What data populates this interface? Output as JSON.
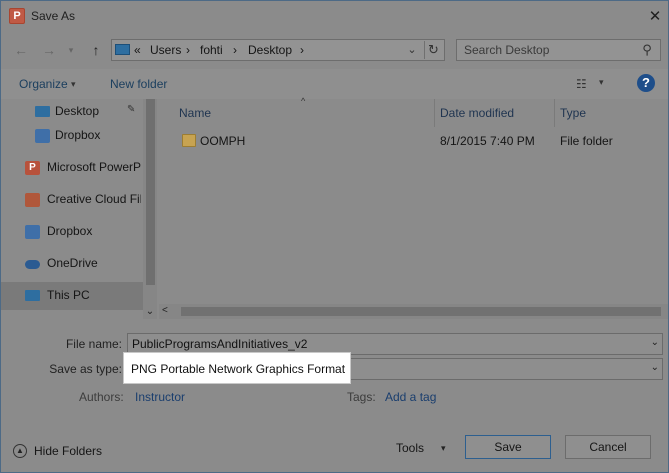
{
  "window": {
    "title": "Save As",
    "app_icon_letter": "P",
    "close_glyph": "✕"
  },
  "nav": {
    "back_glyph": "←",
    "forward_glyph": "→",
    "up_glyph": "↑",
    "breadcrumb_overflow": "«",
    "breadcrumb": [
      "Users",
      "fohti",
      "Desktop"
    ],
    "crumb_sep": "›",
    "search_placeholder": "Search Desktop"
  },
  "toolbar": {
    "organize_label": "Organize",
    "organize_dd": "▾",
    "new_folder_label": "New folder",
    "help_label": "?"
  },
  "sidebar": {
    "items": [
      {
        "label": "Desktop",
        "icon": "desktop-icon",
        "color": "#2e6ea0"
      },
      {
        "label": "Dropbox",
        "icon": "dropbox-icon",
        "color": "#3f6fa8"
      },
      {
        "label": "Microsoft PowerPoint",
        "icon": "powerpoint-icon",
        "color": "#b8523c",
        "glyph": "P"
      },
      {
        "label": "Creative Cloud Files",
        "icon": "creative-cloud-icon",
        "color": "#b0573b"
      },
      {
        "label": "Dropbox",
        "icon": "dropbox-icon",
        "color": "#3f6fa8"
      },
      {
        "label": "OneDrive",
        "icon": "onedrive-icon",
        "color": "#2b5b92"
      },
      {
        "label": "This PC",
        "icon": "computer-icon",
        "color": "#2e6ea0"
      }
    ]
  },
  "files": {
    "columns": [
      "Name",
      "Date modified",
      "Type"
    ],
    "rows": [
      {
        "name": "OOMPH",
        "date": "8/1/2015 7:40 PM",
        "type": "File folder"
      }
    ]
  },
  "form": {
    "file_name_label": "File name:",
    "file_name_value": "PublicProgramsAndInitiatives_v2",
    "save_type_label": "Save as type:",
    "save_type_value": "PNG Portable Network Graphics Format",
    "authors_label": "Authors:",
    "authors_value": "Instructor",
    "tags_label": "Tags:",
    "tags_value": "Add a tag"
  },
  "footer": {
    "hide_folders_label": "Hide Folders",
    "tools_label": "Tools",
    "save_label": "Save",
    "cancel_label": "Cancel"
  }
}
